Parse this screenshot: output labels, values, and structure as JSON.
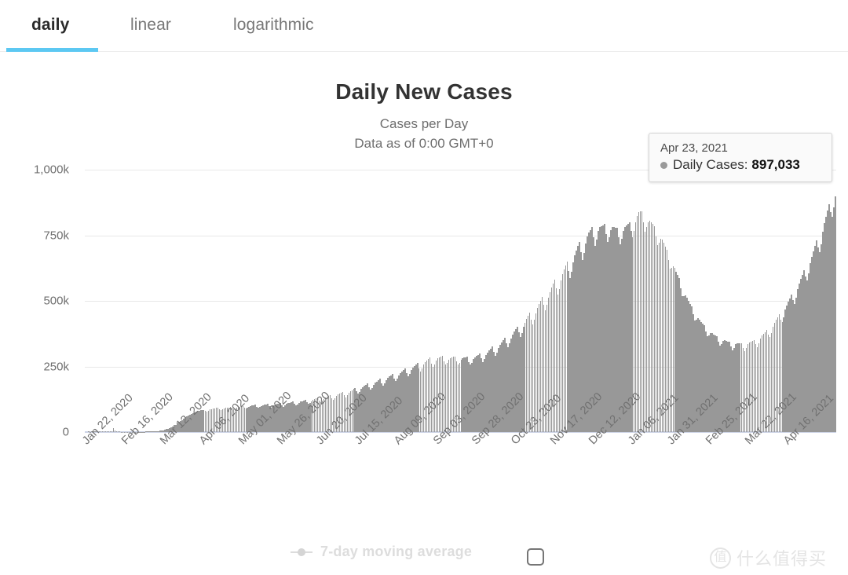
{
  "tabs": [
    {
      "label": "daily",
      "active": true,
      "left": 40
    },
    {
      "label": "linear",
      "active": false,
      "left": 166
    },
    {
      "label": "logarithmic",
      "active": false,
      "left": 297
    }
  ],
  "header": {
    "title": "Daily New Cases",
    "subtitle": "Cases per Day",
    "data_as_of": "Data as of 0:00 GMT+0"
  },
  "tooltip": {
    "date": "Apr 23, 2021",
    "series_label": "Daily Cases:",
    "value": "897,033",
    "dot_color": "#9a9a9a"
  },
  "legend": {
    "label": "7-day moving average",
    "checkbox_checked": false
  },
  "watermark": {
    "logo_glyph": "值",
    "text": "什么值得买"
  },
  "colors": {
    "accent": "#5cc8f2",
    "bar": "#989898",
    "gridline": "#e8e8e8",
    "axis": "#ccd3e6",
    "tab_active_text": "#2a2a2a",
    "tab_text": "#777777"
  },
  "chart_data": {
    "type": "bar",
    "title": "Daily New Cases",
    "subtitle": "Cases per Day",
    "xlabel": "",
    "ylabel": "",
    "ylim": [
      0,
      1000000
    ],
    "grid": true,
    "legend_position": "bottom",
    "ytick_labels": [
      "0",
      "250k",
      "500k",
      "750k",
      "1,000k"
    ],
    "ytick_values": [
      0,
      250000,
      500000,
      750000,
      1000000
    ],
    "xtick_labels": [
      "Jan 22, 2020",
      "Feb 16, 2020",
      "Mar 12, 2020",
      "Apr 06, 2020",
      "May 01, 2020",
      "May 26, 2020",
      "Jun 20, 2020",
      "Jul 15, 2020",
      "Aug 09, 2020",
      "Sep 03, 2020",
      "Sep 28, 2020",
      "Oct 23, 2020",
      "Nov 17, 2020",
      "Dec 12, 2020",
      "Jan 06, 2021",
      "Jan 31, 2021",
      "Feb 25, 2021",
      "Mar 22, 2021",
      "Apr 16, 2021"
    ],
    "xtick_interval_days": 25,
    "x_start": "Jan 22, 2020",
    "x_end": "Apr 23, 2021",
    "series": [
      {
        "name": "Daily Cases",
        "color": "#989898",
        "highlight_point": {
          "x": "Apr 23, 2021",
          "y": 897033
        },
        "values": [
          98,
          0,
          1800,
          1500,
          2100,
          2600,
          2800,
          3200,
          3900,
          3700,
          3150,
          2700,
          2600,
          2050,
          2050,
          1900,
          1800,
          2000,
          15150,
          5100,
          2650,
          2050,
          2000,
          900,
          900,
          700,
          600,
          500,
          450,
          900,
          800,
          700,
          600,
          550,
          800,
          1000,
          1300,
          1100,
          1200,
          1700,
          2000,
          2100,
          2500,
          2700,
          3000,
          3600,
          4000,
          4500,
          4900,
          5500,
          6800,
          8800,
          10600,
          12500,
          16100,
          18000,
          21000,
          25500,
          28000,
          34000,
          38000,
          42000,
          45000,
          51000,
          57000,
          60000,
          64000,
          67000,
          70000,
          73000,
          76000,
          79000,
          80000,
          81000,
          83000,
          85000,
          84000,
          80000,
          79000,
          82000,
          86000,
          88000,
          90000,
          91000,
          92000,
          93000,
          88000,
          84000,
          86000,
          90000,
          92000,
          93000,
          94000,
          95000,
          92000,
          87000,
          90000,
          94000,
          96000,
          97000,
          98000,
          100000,
          94000,
          90000,
          92000,
          96000,
          99000,
          101000,
          102000,
          104000,
          97000,
          92000,
          95000,
          100000,
          103000,
          104000,
          105000,
          107000,
          99000,
          94000,
          98000,
          103000,
          106000,
          108000,
          109000,
          111000,
          103000,
          97000,
          101000,
          107000,
          110000,
          112000,
          114000,
          116000,
          107000,
          101000,
          106000,
          112000,
          116000,
          118000,
          120000,
          123000,
          113000,
          107000,
          112000,
          118000,
          123000,
          126000,
          128000,
          131000,
          121000,
          114000,
          120000,
          127000,
          132000,
          135000,
          138000,
          141000,
          130000,
          123000,
          129000,
          137000,
          143000,
          147000,
          150000,
          153000,
          141000,
          133000,
          140000,
          149000,
          156000,
          160000,
          164000,
          168000,
          155000,
          146000,
          154000,
          164000,
          171000,
          176000,
          180000,
          185000,
          170000,
          161000,
          169000,
          180000,
          188000,
          193000,
          198000,
          203000,
          187000,
          177000,
          186000,
          198000,
          207000,
          212000,
          217000,
          222000,
          205000,
          194000,
          204000,
          217000,
          226000,
          232000,
          237000,
          243000,
          224000,
          212000,
          222000,
          236000,
          246000,
          252000,
          258000,
          264000,
          244000,
          231000,
          242000,
          257000,
          267000,
          273000,
          278000,
          283000,
          262000,
          249000,
          259000,
          272000,
          280000,
          284000,
          287000,
          290000,
          270000,
          257000,
          265000,
          276000,
          282000,
          285000,
          287000,
          288000,
          269000,
          257000,
          264000,
          274000,
          280000,
          283000,
          285000,
          286000,
          268000,
          257000,
          265000,
          277000,
          285000,
          290000,
          294000,
          298000,
          280000,
          268000,
          278000,
          292000,
          303000,
          311000,
          318000,
          325000,
          305000,
          291000,
          303000,
          320000,
          333000,
          342000,
          351000,
          360000,
          339000,
          323000,
          337000,
          356000,
          371000,
          382000,
          392000,
          402000,
          379000,
          362000,
          378000,
          400000,
          417000,
          430000,
          442000,
          454000,
          429000,
          410000,
          428000,
          453000,
          472000,
          487000,
          500000,
          514000,
          486000,
          465000,
          485000,
          513000,
          534000,
          551000,
          565000,
          580000,
          548000,
          524000,
          546000,
          577000,
          601000,
          620000,
          635000,
          650000,
          615000,
          588000,
          612000,
          647000,
          673000,
          693000,
          709000,
          725000,
          687000,
          657000,
          683000,
          720000,
          745000,
          760000,
          770000,
          782000,
          742000,
          711000,
          735000,
          766000,
          780000,
          785000,
          788000,
          792000,
          754000,
          724000,
          744000,
          770000,
          780000,
          780000,
          778000,
          777000,
          742000,
          715000,
          736000,
          766000,
          780000,
          787000,
          792000,
          800000,
          767000,
          742000,
          766000,
          800000,
          823000,
          838000,
          842000,
          840000,
          800000,
          765000,
          780000,
          800000,
          805000,
          800000,
          792000,
          785000,
          745000,
          712000,
          722000,
          736000,
          733000,
          722000,
          708000,
          695000,
          656000,
          622000,
          625000,
          632000,
          625000,
          612000,
          598000,
          586000,
          548000,
          517000,
          518000,
          521000,
          512000,
          499000,
          487000,
          478000,
          448000,
          424000,
          427000,
          433000,
          428000,
          420000,
          413000,
          408000,
          384000,
          365000,
          369000,
          378000,
          376000,
          371000,
          367000,
          365000,
          344000,
          329000,
          336000,
          348000,
          349000,
          347000,
          345000,
          344000,
          325000,
          312000,
          320000,
          334000,
          337000,
          337000,
          337000,
          338000,
          321000,
          309000,
          319000,
          335000,
          341000,
          344000,
          347000,
          351000,
          334000,
          324000,
          337000,
          357000,
          367000,
          374000,
          381000,
          389000,
          372000,
          362000,
          378000,
          402000,
          416000,
          427000,
          437000,
          448000,
          429000,
          418000,
          437000,
          466000,
          483000,
          497000,
          510000,
          523000,
          502000,
          489000,
          512000,
          546000,
          567000,
          584000,
          600000,
          617000,
          593000,
          578000,
          604000,
          644000,
          669000,
          690000,
          710000,
          731000,
          703000,
          687000,
          717000,
          764000,
          795000,
          820000,
          843000,
          869000,
          838000,
          820000,
          856000,
          897033
        ]
      }
    ]
  }
}
